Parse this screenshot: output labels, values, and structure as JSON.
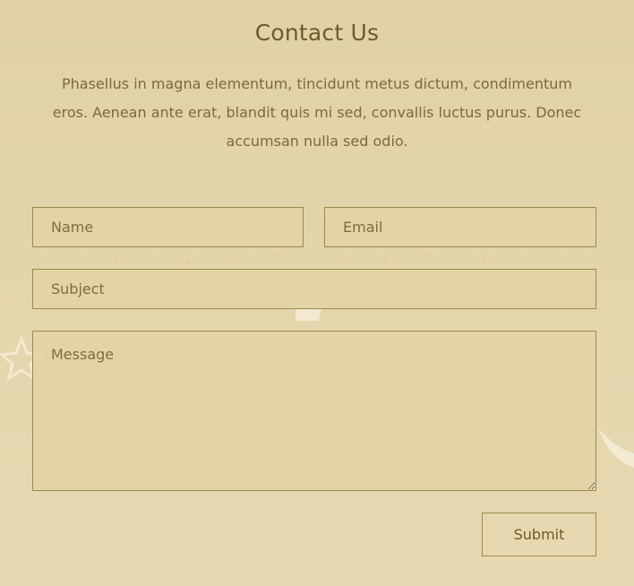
{
  "page": {
    "title": "Contact Us",
    "intro": "Phasellus in magna elementum, tincidunt metus dictum, condimentum eros. Aenean ante erat, blandit quis mi sed, convallis luctus purus. Donec accumsan nulla sed odio."
  },
  "form": {
    "name_placeholder": "Name",
    "email_placeholder": "Email",
    "subject_placeholder": "Subject",
    "message_placeholder": "Message",
    "submit_label": "Submit"
  },
  "colors": {
    "background": "#e2d4a8",
    "text": "#6b5b2c",
    "border": "#9c8a4a"
  }
}
